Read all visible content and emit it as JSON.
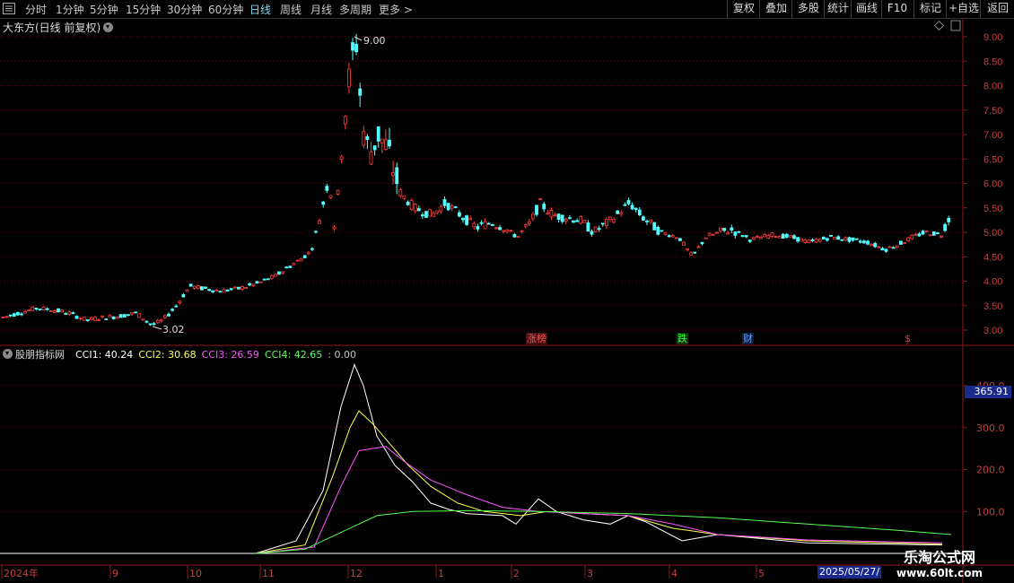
{
  "toolbar": {
    "periods": [
      "分时",
      "1分钟",
      "5分钟",
      "15分钟",
      "30分钟",
      "60分钟",
      "日线",
      "周线",
      "月线",
      "多周期",
      "更多 >"
    ],
    "active_period": "日线",
    "buttons": [
      "复权",
      "叠加",
      "多股",
      "统计",
      "画线",
      "F10",
      "标记",
      "+自选",
      "返回"
    ]
  },
  "main": {
    "title": "大东方(日线 前复权)",
    "y_ticks": [
      "9.00",
      "8.50",
      "8.00",
      "7.50",
      "7.00",
      "6.50",
      "6.00",
      "5.50",
      "5.00",
      "4.50",
      "4.00",
      "3.50",
      "3.00"
    ],
    "high_label": "9.00",
    "low_label": "3.02",
    "events": [
      {
        "text": "涨榜",
        "color": "#ff5050",
        "bg": "#3a1010"
      },
      {
        "text": "跌",
        "color": "#40ff40",
        "bg": "#103010"
      },
      {
        "text": "财",
        "color": "#5aa0ff",
        "bg": "#101a3a"
      },
      {
        "text": "$",
        "color": "#ff3030",
        "bg": "#000000"
      }
    ]
  },
  "indicator": {
    "name": "股朋指标网",
    "values": [
      {
        "label": "CCI1: 40.24",
        "color": "#ffffff"
      },
      {
        "label": "CCI2: 30.68",
        "color": "#ffff55"
      },
      {
        "label": "CCI3: 26.59",
        "color": "#ff55ff"
      },
      {
        "label": "CCI4: 42.65",
        "color": "#55ff55"
      },
      {
        "label": ": 0.00",
        "color": "#c0c0c0"
      }
    ],
    "y_ticks": [
      "400.0",
      "300.0",
      "200.0",
      "100.0"
    ],
    "current_value": "365.91"
  },
  "x_axis": {
    "labels": [
      "2024年",
      "9",
      "10",
      "11",
      "12",
      "1",
      "2",
      "3",
      "4",
      "5"
    ],
    "cursor_date": "2025/05/27/"
  },
  "watermark": {
    "line1": "乐淘公式网",
    "line2": "www.60lt.com"
  },
  "chart_data": {
    "type": "candlestick",
    "title": "大东方(日线 前复权)",
    "y_range": [
      2.9,
      9.1
    ],
    "price_path": [
      [
        0,
        3.25
      ],
      [
        20,
        3.35
      ],
      [
        40,
        3.45
      ],
      [
        55,
        3.42
      ],
      [
        75,
        3.35
      ],
      [
        95,
        3.2
      ],
      [
        110,
        3.25
      ],
      [
        130,
        3.28
      ],
      [
        150,
        3.35
      ],
      [
        168,
        3.1
      ],
      [
        180,
        3.2
      ],
      [
        195,
        3.5
      ],
      [
        210,
        3.9
      ],
      [
        225,
        3.85
      ],
      [
        245,
        3.8
      ],
      [
        265,
        3.85
      ],
      [
        285,
        3.95
      ],
      [
        305,
        4.1
      ],
      [
        325,
        4.35
      ],
      [
        345,
        4.6
      ],
      [
        355,
        5.3
      ],
      [
        365,
        6.1
      ],
      [
        372,
        5.0
      ],
      [
        380,
        7.0
      ],
      [
        390,
        8.5
      ],
      [
        396,
        8.9
      ],
      [
        402,
        7.2
      ],
      [
        410,
        6.6
      ],
      [
        420,
        7.0
      ],
      [
        430,
        6.7
      ],
      [
        445,
        5.8
      ],
      [
        460,
        5.5
      ],
      [
        480,
        5.35
      ],
      [
        495,
        5.6
      ],
      [
        515,
        5.3
      ],
      [
        530,
        5.1
      ],
      [
        545,
        5.2
      ],
      [
        560,
        5.1
      ],
      [
        575,
        4.9
      ],
      [
        590,
        5.2
      ],
      [
        600,
        5.6
      ],
      [
        615,
        5.35
      ],
      [
        630,
        5.3
      ],
      [
        645,
        5.25
      ],
      [
        660,
        5.0
      ],
      [
        680,
        5.25
      ],
      [
        700,
        5.6
      ],
      [
        715,
        5.3
      ],
      [
        735,
        5.0
      ],
      [
        755,
        4.9
      ],
      [
        770,
        4.5
      ],
      [
        785,
        4.9
      ],
      [
        800,
        5.0
      ],
      [
        815,
        5.05
      ],
      [
        835,
        4.85
      ],
      [
        860,
        4.95
      ],
      [
        880,
        4.9
      ],
      [
        900,
        4.8
      ],
      [
        925,
        4.9
      ],
      [
        945,
        4.85
      ],
      [
        965,
        4.8
      ],
      [
        985,
        4.65
      ],
      [
        1000,
        4.75
      ],
      [
        1015,
        4.9
      ],
      [
        1030,
        5.0
      ],
      [
        1048,
        4.95
      ],
      [
        1055,
        5.3
      ],
      [
        1060,
        5.1
      ]
    ],
    "cci_series": [
      {
        "name": "CCI1",
        "color": "#ffffff",
        "points": [
          [
            285,
            0
          ],
          [
            330,
            30
          ],
          [
            360,
            150
          ],
          [
            380,
            350
          ],
          [
            395,
            450
          ],
          [
            405,
            400
          ],
          [
            420,
            280
          ],
          [
            440,
            210
          ],
          [
            460,
            170
          ],
          [
            480,
            120
          ],
          [
            500,
            105
          ],
          [
            520,
            95
          ],
          [
            560,
            90
          ],
          [
            575,
            70
          ],
          [
            600,
            130
          ],
          [
            620,
            100
          ],
          [
            650,
            80
          ],
          [
            680,
            70
          ],
          [
            700,
            90
          ],
          [
            720,
            75
          ],
          [
            760,
            30
          ],
          [
            800,
            45
          ],
          [
            850,
            35
          ],
          [
            900,
            25
          ],
          [
            1050,
            20
          ]
        ]
      },
      {
        "name": "CCI2",
        "color": "#ffff55",
        "points": [
          [
            285,
            0
          ],
          [
            340,
            20
          ],
          [
            370,
            180
          ],
          [
            390,
            300
          ],
          [
            400,
            340
          ],
          [
            415,
            310
          ],
          [
            435,
            260
          ],
          [
            455,
            210
          ],
          [
            480,
            160
          ],
          [
            510,
            120
          ],
          [
            540,
            100
          ],
          [
            580,
            90
          ],
          [
            610,
            100
          ],
          [
            650,
            95
          ],
          [
            700,
            90
          ],
          [
            750,
            60
          ],
          [
            800,
            45
          ],
          [
            900,
            30
          ],
          [
            1050,
            22
          ]
        ]
      },
      {
        "name": "CCI3",
        "color": "#ff55ff",
        "points": [
          [
            285,
            0
          ],
          [
            350,
            15
          ],
          [
            380,
            160
          ],
          [
            400,
            245
          ],
          [
            430,
            255
          ],
          [
            450,
            220
          ],
          [
            480,
            175
          ],
          [
            520,
            140
          ],
          [
            560,
            110
          ],
          [
            600,
            100
          ],
          [
            650,
            95
          ],
          [
            700,
            90
          ],
          [
            750,
            70
          ],
          [
            800,
            45
          ],
          [
            900,
            32
          ],
          [
            1050,
            25
          ]
        ]
      },
      {
        "name": "CCI4",
        "color": "#55ff55",
        "points": [
          [
            285,
            0
          ],
          [
            340,
            10
          ],
          [
            380,
            50
          ],
          [
            420,
            90
          ],
          [
            460,
            100
          ],
          [
            520,
            102
          ],
          [
            600,
            100
          ],
          [
            700,
            95
          ],
          [
            800,
            85
          ],
          [
            900,
            70
          ],
          [
            1000,
            55
          ],
          [
            1060,
            45
          ]
        ]
      }
    ],
    "cci_range": [
      -25,
      460
    ]
  }
}
